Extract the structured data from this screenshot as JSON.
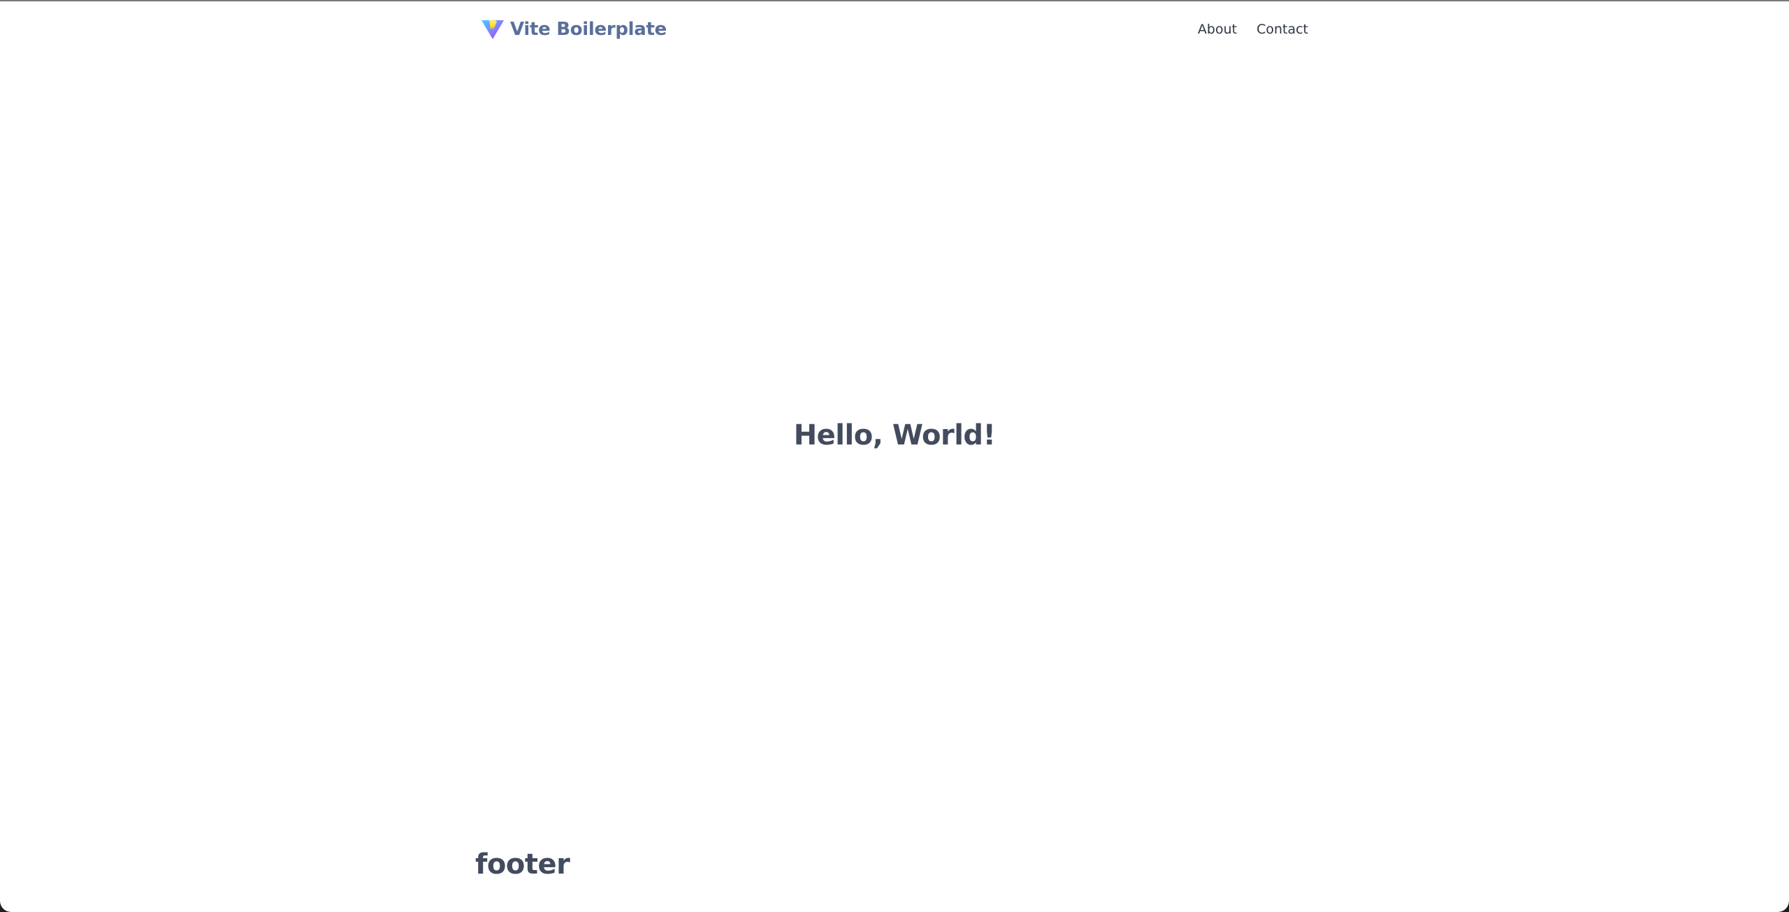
{
  "header": {
    "brand": "Vite Boilerplate",
    "logo_icon": "vite-logo-icon",
    "nav": [
      {
        "label": "About"
      },
      {
        "label": "Contact"
      }
    ]
  },
  "main": {
    "heading": "Hello, World!"
  },
  "footer": {
    "text": "footer"
  },
  "colors": {
    "brand": "#5a6f9a",
    "heading": "#434b5e",
    "nav": "#2f3545",
    "logo_purple": "#a259ff",
    "logo_yellow": "#ffd62e"
  }
}
